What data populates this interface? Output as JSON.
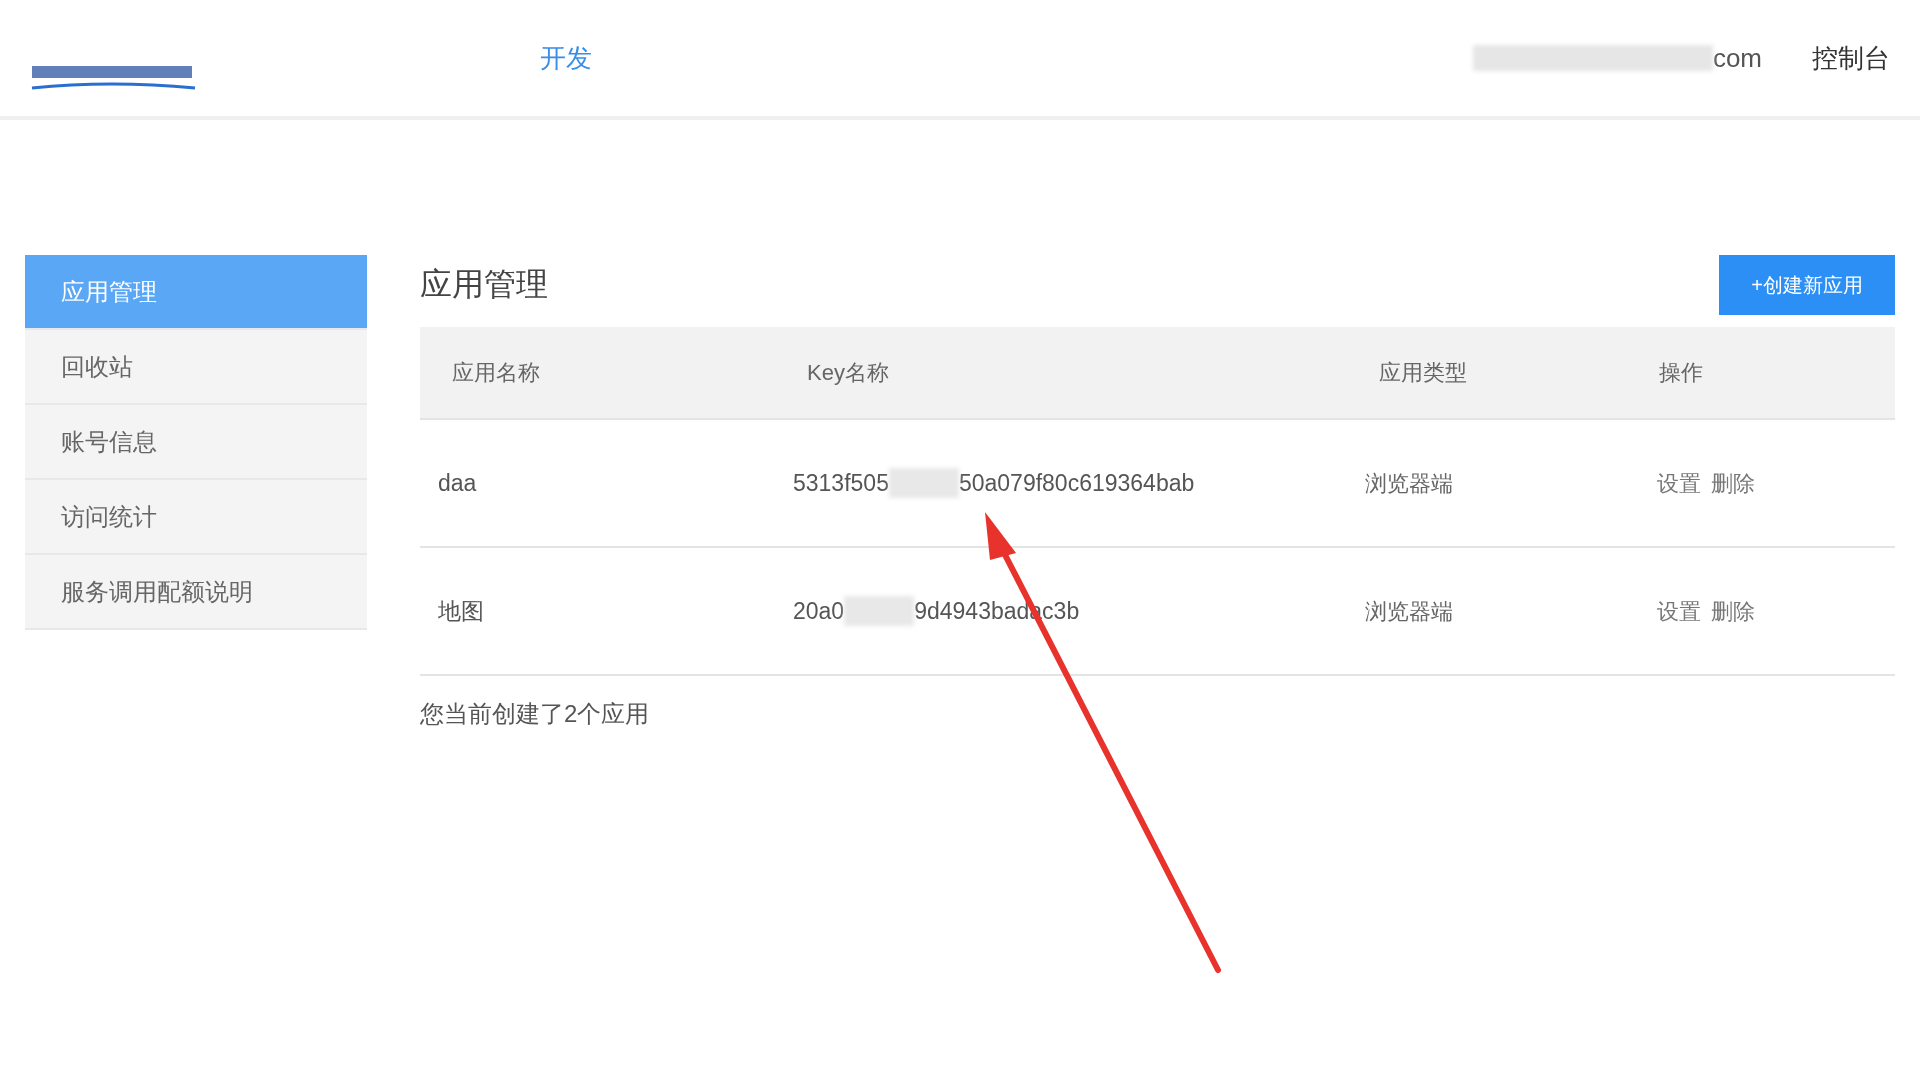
{
  "header": {
    "nav": [
      {
        "label": "开发",
        "selected": true
      }
    ],
    "account_suffix": "com",
    "console_link": "控制台"
  },
  "sidebar": {
    "items": [
      {
        "label": "应用管理",
        "selected": true
      },
      {
        "label": "回收站",
        "selected": false
      },
      {
        "label": "账号信息",
        "selected": false
      },
      {
        "label": "访问统计",
        "selected": false
      },
      {
        "label": "服务调用配额说明",
        "selected": false
      }
    ]
  },
  "main": {
    "title": "应用管理",
    "create_button": "+创建新应用",
    "table": {
      "columns": [
        "应用名称",
        "Key名称",
        "应用类型",
        "操作"
      ],
      "rows": [
        {
          "name": "daa",
          "key_start": "5313f505",
          "key_end": "50a079f80c619364bab",
          "type": "浏览器端",
          "actions": [
            "设置",
            "删除"
          ]
        },
        {
          "name": "地图",
          "key_start": "20a0",
          "key_end": "9d4943badac3b",
          "type": "浏览器端",
          "actions": [
            "设置",
            "删除"
          ]
        }
      ]
    },
    "summary": "您当前创建了2个应用"
  }
}
